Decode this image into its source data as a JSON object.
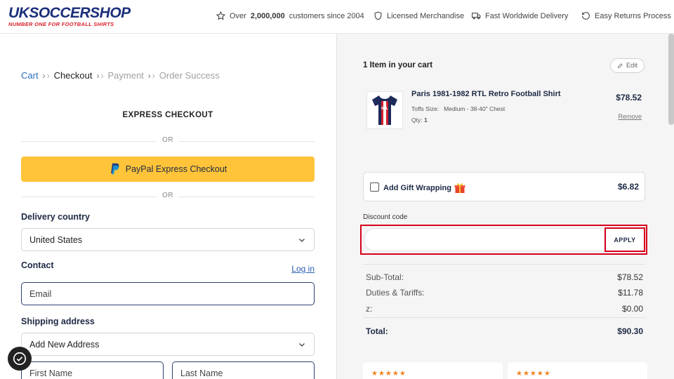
{
  "header": {
    "logo_main": "UKSOCCERSHOP",
    "logo_sub": "NUMBER ONE FOR FOOTBALL SHIRTS",
    "items": [
      {
        "icon": "star-icon",
        "prefix": "Over",
        "bold": "2,000,000",
        "suffix": "customers since 2004"
      },
      {
        "icon": "shield-icon",
        "text": "Licensed Merchandise"
      },
      {
        "icon": "truck-icon",
        "text": "Fast Worldwide Delivery"
      },
      {
        "icon": "return-icon",
        "text": "Easy Returns Process"
      }
    ]
  },
  "breadcrumb": {
    "items": [
      "Cart",
      "Checkout",
      "Payment",
      "Order Success"
    ]
  },
  "express": {
    "title": "EXPRESS CHECKOUT",
    "or_top": "OR",
    "paypal_label": "PayPal Express Checkout",
    "or_bottom": "OR"
  },
  "form": {
    "delivery_country_label": "Delivery country",
    "delivery_country_value": "United States",
    "contact_label": "Contact",
    "login_link": "Log in",
    "email_placeholder": "Email",
    "shipping_label": "Shipping address",
    "address_value": "Add New Address",
    "first_name_placeholder": "First Name",
    "last_name_placeholder": "Last Name"
  },
  "cart": {
    "title": "1 Item in your cart",
    "edit_label": "Edit",
    "product": {
      "name": "Paris 1981-1982 RTL Retro Football Shirt",
      "size_label": "Toffs Size:",
      "size_value": "Medium - 38-40\" Chest",
      "qty_label": "Qty:",
      "qty_value": "1",
      "price": "$78.52",
      "remove_label": "Remove"
    },
    "gift": {
      "label": "Add Gift Wrapping",
      "price": "$6.82",
      "checked": false
    },
    "discount": {
      "label": "Discount code",
      "value": "",
      "apply_label": "APPLY"
    },
    "summary": [
      {
        "label": "Sub-Total:",
        "value": "$78.52"
      },
      {
        "label": "Duties & Tariffs:",
        "value": "$11.78"
      },
      {
        "label": "z:",
        "value": "$0.00"
      }
    ],
    "total": {
      "label": "Total:",
      "value": "$90.30"
    },
    "reviews": {
      "stars": "★★★★★"
    }
  },
  "colors": {
    "brand_navy": "#1b2f7a",
    "brand_red": "#d8202b",
    "paypal_yellow": "#ffc43a",
    "link_blue": "#2a6ebb",
    "highlight_red": "#d6001c"
  }
}
